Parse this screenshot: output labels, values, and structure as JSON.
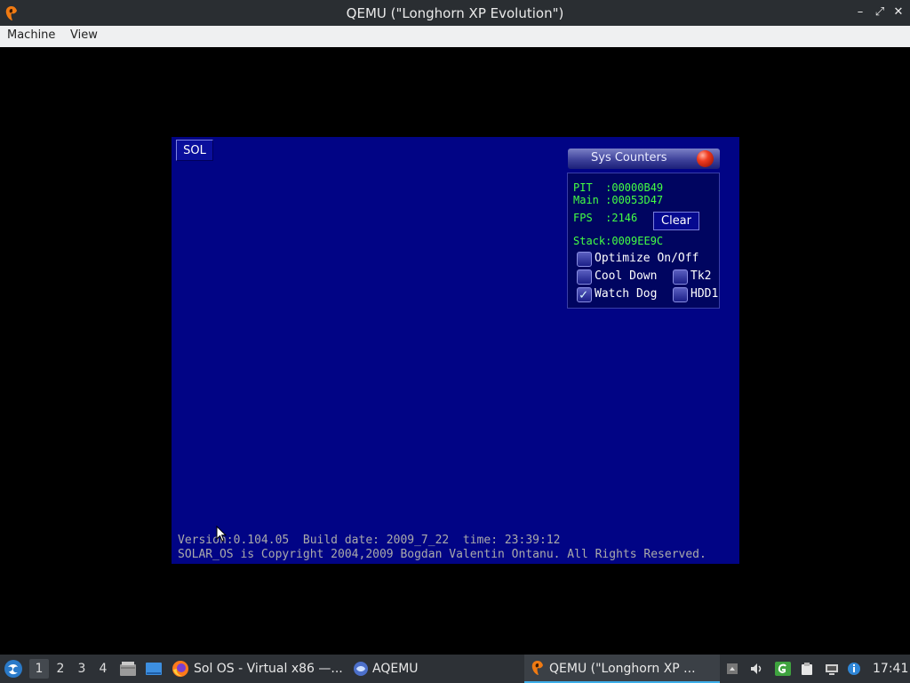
{
  "window": {
    "title": "QEMU (\"Longhorn XP Evolution\")"
  },
  "window_controls": {
    "minimize": "–",
    "restore": "⤢",
    "close": "✕"
  },
  "menubar": {
    "items": [
      {
        "label": "Machine"
      },
      {
        "label": "View"
      }
    ]
  },
  "guest": {
    "sol_button": "SOL",
    "sys_counters": {
      "title": "Sys Counters",
      "pit": "PIT  :00000B49",
      "main": "Main :00053D47",
      "fps": "FPS  :2146",
      "clear_label": "Clear",
      "stack": "Stack:0009EE9C",
      "options": [
        {
          "label": "Optimize On/Off",
          "checked": false
        },
        {
          "label": "Cool Down",
          "checked": false
        },
        {
          "label": "Tk2",
          "checked": false
        },
        {
          "label": "Watch Dog",
          "checked": true
        },
        {
          "label": "HDD1",
          "checked": false
        }
      ]
    },
    "footer_line1": "Version:0.104.05  Build date: 2009_7_22  time: 23:39:12",
    "footer_line2": "SOLAR_OS is Copyright 2004,2009 Bogdan Valentin Ontanu. All Rights Reserved."
  },
  "taskbar": {
    "workspaces": [
      "1",
      "2",
      "3",
      "4"
    ],
    "active_workspace": "1",
    "tasks": [
      {
        "label": "Sol OS - Virtual x86 —...",
        "icon": "firefox-icon"
      },
      {
        "label": "AQEMU",
        "icon": "aqemu-icon"
      },
      {
        "label": "QEMU (\"Longhorn XP ...",
        "icon": "qemu-icon",
        "active": true
      }
    ],
    "clock": "17:41"
  },
  "colors": {
    "guest_background": "#010485",
    "counter_text": "#44ff44",
    "footer_text": "#aaaaaa",
    "titlebar": "#2a2e32",
    "taskbar": "#2d3136"
  }
}
